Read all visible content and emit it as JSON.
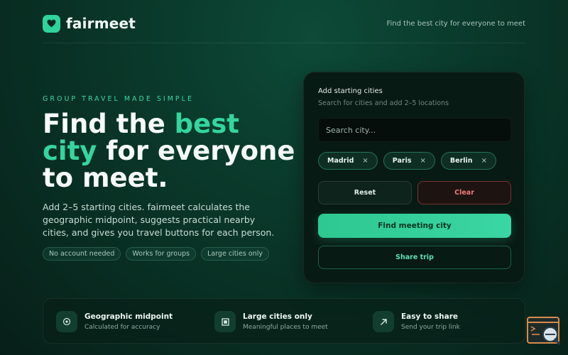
{
  "brand": {
    "name": "fairmeet",
    "tagline": "Find the best city for everyone to meet"
  },
  "hero": {
    "eyebrow": "GROUP TRAVEL MADE SIMPLE",
    "headline_1": "Find the ",
    "headline_accent_1": "best",
    "headline_accent_2": "city",
    "headline_2": " for everyone to meet.",
    "description": "Add 2–5 starting cities. fairmeet calculates the geographic midpoint, suggests practical nearby cities, and gives you travel buttons for each person.",
    "chips": [
      "No account needed",
      "Works for groups",
      "Large cities only"
    ]
  },
  "card": {
    "title": "Add starting cities",
    "subtitle": "Search for cities and add 2–5 locations",
    "search_placeholder": "Search city...",
    "cities": [
      "Madrid",
      "Paris",
      "Berlin"
    ],
    "remove_glyph": "×",
    "reset_label": "Reset",
    "clear_label": "Clear",
    "find_label": "Find meeting city",
    "share_label": "Share trip"
  },
  "features": [
    {
      "icon": "target-icon",
      "title": "Geographic midpoint",
      "subtitle": "Calculated for accuracy"
    },
    {
      "icon": "building-icon",
      "title": "Large cities only",
      "subtitle": "Meaningful places to meet"
    },
    {
      "icon": "arrow-up-right-icon",
      "title": "Easy to share",
      "subtitle": "Send your trip link"
    }
  ],
  "colors": {
    "accent": "#34d69e",
    "danger": "#f07a7a",
    "background": "#0a3a2b"
  }
}
